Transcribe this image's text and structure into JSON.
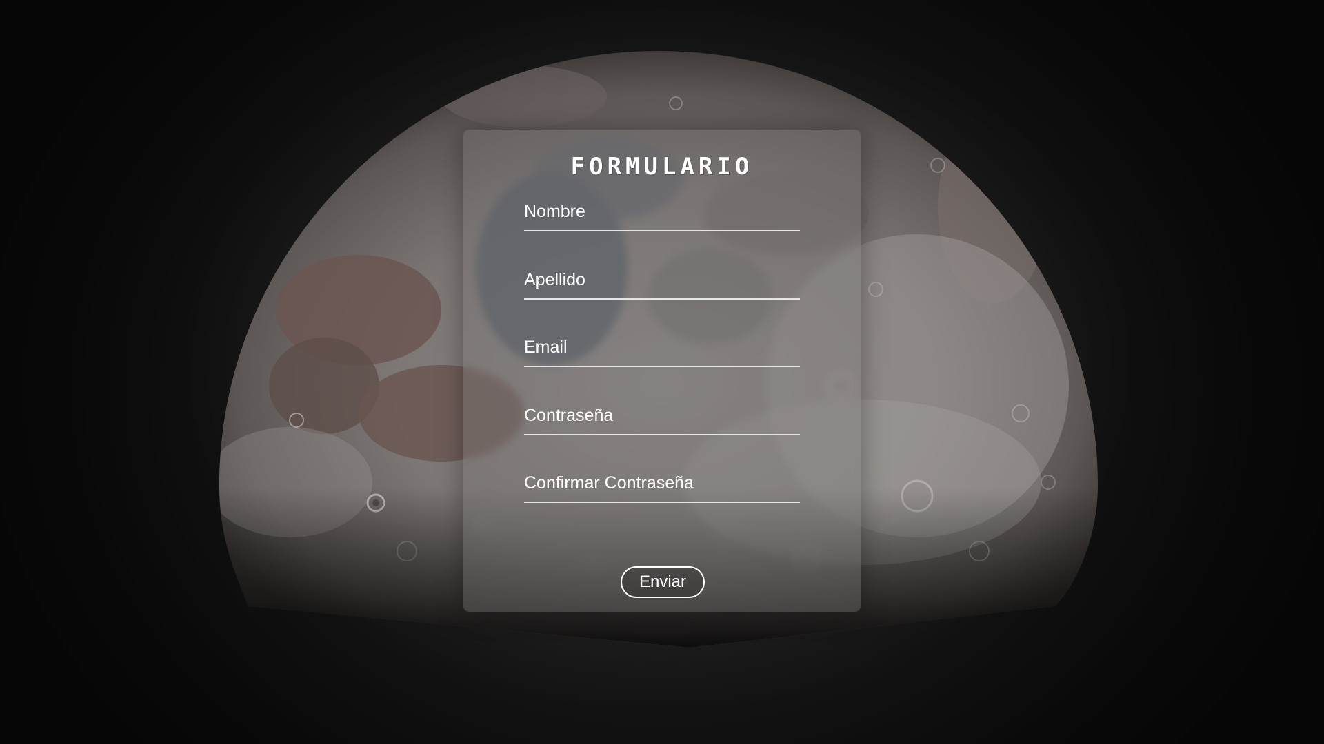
{
  "form": {
    "title": "FORMULARIO",
    "fields": [
      {
        "placeholder": "Nombre",
        "value": ""
      },
      {
        "placeholder": "Apellido",
        "value": ""
      },
      {
        "placeholder": "Email",
        "value": ""
      },
      {
        "placeholder": "Contraseña",
        "value": ""
      },
      {
        "placeholder": "Confirmar Contraseña",
        "value": ""
      }
    ],
    "submit_label": "Enviar"
  },
  "colors": {
    "background": "#0b0b0b",
    "text": "#ffffff",
    "underline": "#e6e6e6",
    "card": "#787676"
  }
}
